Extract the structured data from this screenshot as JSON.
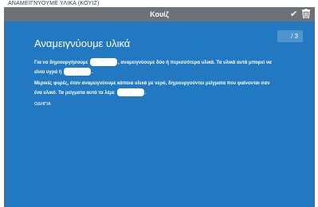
{
  "window": {
    "title": "ΑΝΑΜΕΙΓΝΥΟΥΜΕ ΥΛΙΚΑ (ΚΟΥΙΖ)"
  },
  "header": {
    "title": "Κουίζ"
  },
  "quiz": {
    "counter": "/ 3",
    "title": "Αναμειγνύουμε υλικά",
    "para1": {
      "part1": "Για να δημιουργήσουμε",
      "part2": ", αναμειγνύουμε δύο ή περισσότερα υλικά. Τα υλικά αυτά μπορεί να",
      "part3": "είναι υγρά ή",
      "part4": "."
    },
    "para2": {
      "part1": "Μερικές φορές, όταν αναμειγνύουμε κάποια υλικά με νερό, δημιουργούνται μείγματα που φαίνονται σαν",
      "part2": "ένα υλικό. Τα μείγματα αυτά τα λέμε",
      "part3": "."
    },
    "blanks": {
      "b1": "-",
      "b2": "-",
      "b3": "-"
    },
    "hint": "ΟΔΗΓΙΑ"
  },
  "colors": {
    "panel": "#2279c2",
    "header": "#6d7277",
    "frame": "#5f6468"
  },
  "icons": {
    "confirm": "check-icon",
    "delete": "trash-icon"
  }
}
